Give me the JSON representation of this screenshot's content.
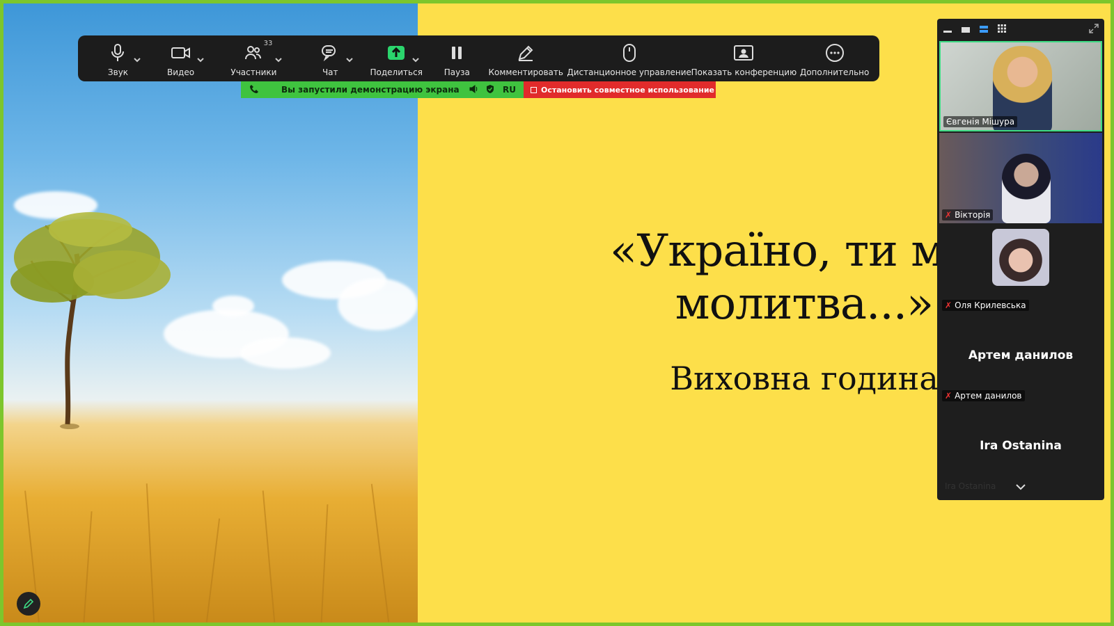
{
  "slide": {
    "title": "«Україно, ти моя\nмолитва...»",
    "subtitle": "Виховна година"
  },
  "toolbar": {
    "audio": "Звук",
    "video": "Видео",
    "participants": "Участники",
    "participants_count": "33",
    "chat": "Чат",
    "share": "Поделиться",
    "pause": "Пауза",
    "annotate": "Комментировать",
    "remote_control": "Дистанционное управление",
    "show_conference": "Показать конференцию",
    "more": "Дополнительно"
  },
  "share_bar": {
    "status": "Вы запустили демонстрацию экрана",
    "lang": "RU",
    "stop": "Остановить совместное использование"
  },
  "gallery": {
    "participants": [
      {
        "name": "Євгенія Мішура",
        "muted": false
      },
      {
        "name": "Вікторія",
        "muted": true
      },
      {
        "name": "Оля Крилевська",
        "muted": true
      },
      {
        "name": "Артем данилов",
        "muted": true,
        "display": "Артем данилов"
      },
      {
        "name": "Ira Ostanina",
        "display": "Ira Ostanina"
      }
    ]
  },
  "colors": {
    "slide_bg": "#fddf4a",
    "border": "#7dc62c",
    "share_green": "#3fc33f",
    "stop_red": "#e12b2b",
    "active_speaker": "#3ddc84"
  }
}
